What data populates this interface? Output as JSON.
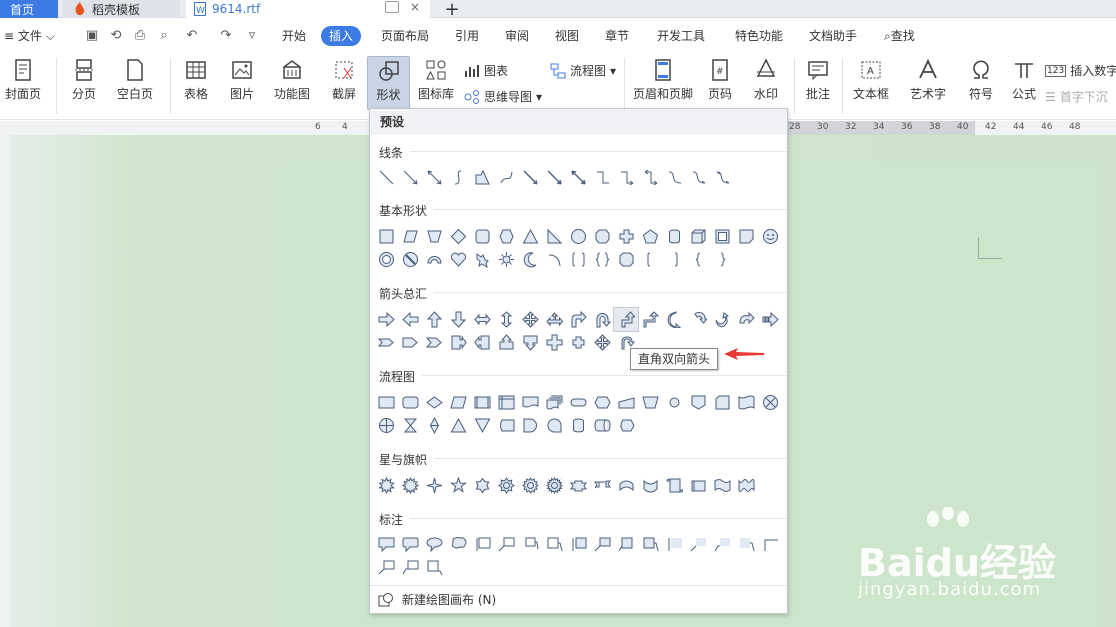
{
  "tabs": {
    "home": "首页",
    "templates": "稻壳模板",
    "document": "9614.rtf"
  },
  "menu": {
    "file": "文件",
    "items": [
      "开始",
      "插入",
      "页面布局",
      "引用",
      "审阅",
      "视图",
      "章节",
      "开发工具",
      "特色功能",
      "文档助手"
    ],
    "search": "查找",
    "active_index": 1
  },
  "ribbon": {
    "cover": "封面页",
    "pagebreak": "分页",
    "blank": "空白页",
    "table": "表格",
    "picture": "图片",
    "funcdiagram": "功能图",
    "screenshot": "截屏",
    "shape": "形状",
    "iconlib": "图标库",
    "chart": "图表",
    "mindmap": "思维导图",
    "flowchart": "流程图",
    "headerfooter": "页眉和页脚",
    "pagenum": "页码",
    "watermark": "水印",
    "comment": "批注",
    "textbox": "文本框",
    "wordart": "艺术字",
    "symbol": "符号",
    "formula": "公式",
    "insertnum": "插入数字",
    "dropcap": "首字下沉"
  },
  "ruler": [
    "6",
    "4",
    "28",
    "30",
    "32",
    "34",
    "36",
    "38",
    "40",
    "42",
    "44",
    "46",
    "48"
  ],
  "dropdown": {
    "header": "预设",
    "sections": [
      "线条",
      "基本形状",
      "箭头总汇",
      "流程图",
      "星与旗帜",
      "标注"
    ],
    "footer": "新建绘图画布 (N)"
  },
  "tooltip": "直角双向箭头",
  "watermark": {
    "main": "Baidu经验",
    "sub": "jingyan.baidu.com"
  },
  "colors": {
    "accent": "#3c7be4",
    "arrow": "#e53935",
    "page": "#cde6cb",
    "icon_fill": "#dfe8f3",
    "icon_stroke": "#4a5d7a"
  }
}
